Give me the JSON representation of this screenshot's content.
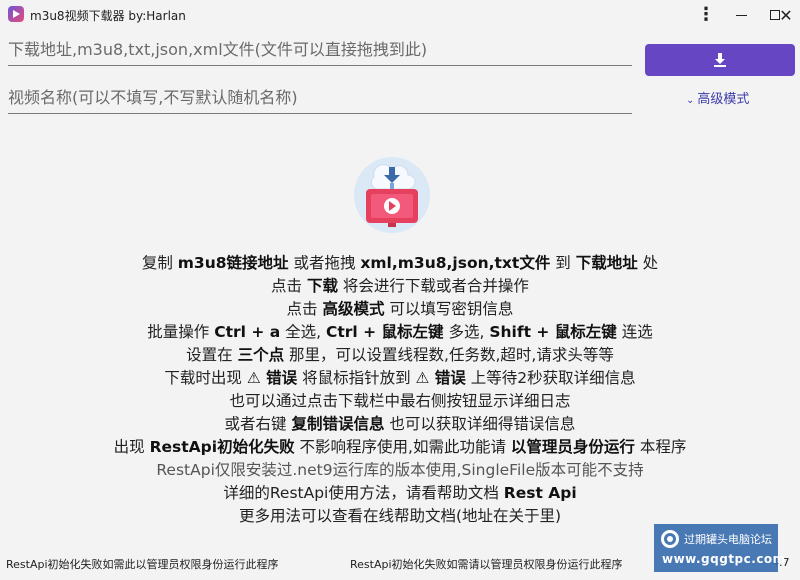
{
  "window": {
    "title": "m3u8视频下载器 by:Harlan"
  },
  "inputs": {
    "url_placeholder": "下载地址,m3u8,txt,json,xml文件(文件可以直接拖拽到此)",
    "name_placeholder": "视频名称(可以不填写,不写默认随机名称)"
  },
  "actions": {
    "download_icon": "download-icon",
    "advanced_label": "高级模式"
  },
  "help": {
    "l1": [
      "复制 ",
      "m3u8链接地址",
      " 或者拖拽 ",
      "xml,m3u8,json,txt文件",
      " 到 ",
      "下载地址",
      " 处"
    ],
    "l2": [
      "点击 ",
      "下载",
      " 将会进行下载或者合并操作"
    ],
    "l3": [
      "点击 ",
      "高级模式",
      " 可以填写密钥信息"
    ],
    "l4": [
      "批量操作 ",
      "Ctrl + a",
      " 全选, ",
      "Ctrl + 鼠标左键",
      " 多选, ",
      "Shift + 鼠标左键",
      " 连选"
    ],
    "l5": [
      "设置在 ",
      "三个点",
      " 那里，可以设置线程数,任务数,超时,请求头等等"
    ],
    "l6": [
      "下载时出现 ",
      "⚠ 错误",
      " 将鼠标指针放到 ",
      "⚠ 错误",
      " 上等待2秒获取详细信息"
    ],
    "l7": "也可以通过点击下载栏中最右侧按钮显示详细日志",
    "l8": [
      "或者右键 ",
      "复制错误信息",
      " 也可以获取详细得错误信息"
    ],
    "l9": [
      "出现 ",
      "RestApi初始化失败",
      " 不影响程序使用,如需此功能请 ",
      "以管理员身份运行",
      " 本程序"
    ],
    "l10": "RestApi仅限安装过.net9运行库的版本使用,SingleFile版本可能不支持",
    "l11": [
      "详细的RestApi使用方法，请看帮助文档 ",
      "Rest Api"
    ],
    "l12": "更多用法可以查看在线帮助文档(地址在关于里)"
  },
  "status": {
    "left": "RestApi初始化失败如需此以管理员权限身份运行此程序",
    "right": "RestApi初始化失败如需请以管理员权限身份运行此程序",
    "version": "4.7"
  },
  "watermark": {
    "name": "过期罐头电脑论坛",
    "url": "www.gqgtpc.com"
  },
  "colors": {
    "accent": "#6746c3",
    "link": "#3d3da8"
  }
}
